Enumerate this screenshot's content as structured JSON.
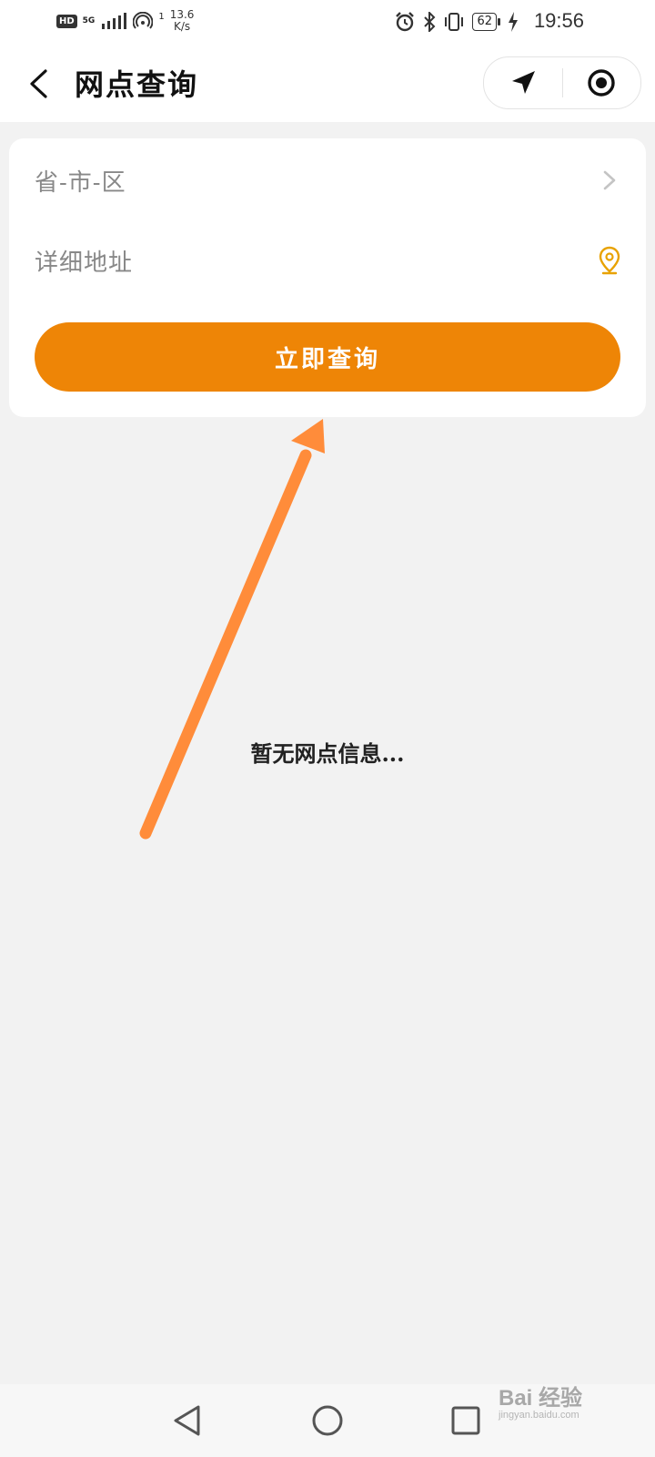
{
  "status_bar": {
    "hd": "HD",
    "network": "5G",
    "hotspot_count": "1",
    "speed_value": "13.6",
    "speed_unit": "K/s",
    "battery": "62",
    "time": "19:56"
  },
  "nav": {
    "title": "网点查询",
    "icons": [
      "back-icon",
      "location-arrow-icon",
      "record-icon"
    ]
  },
  "form": {
    "region_label": "省-市-区",
    "address_placeholder": "详细地址",
    "query_button": "立即查询"
  },
  "empty_state": "暂无网点信息...",
  "watermark": {
    "brand": "Bai 经验",
    "url": "jingyan.baidu.com"
  },
  "colors": {
    "accent": "#ee8506",
    "annotation_arrow": "#ff8c3a",
    "location_pin": "#e8a200",
    "background": "#f2f2f2"
  }
}
